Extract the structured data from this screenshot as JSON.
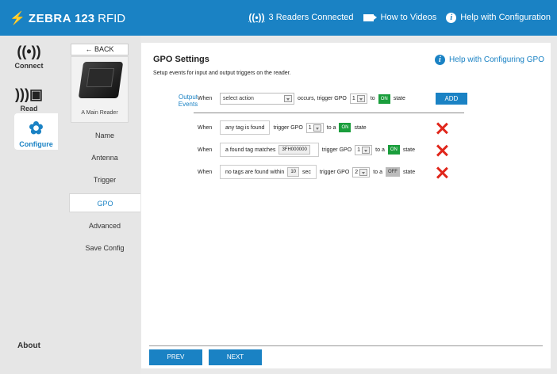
{
  "header": {
    "brand_name": "ZEBRA",
    "brand_product": "123",
    "brand_product_suffix": "RFID",
    "readers_connected": "3 Readers Connected",
    "how_to_videos": "How to Videos",
    "help_config": "Help with Configuration"
  },
  "nav": {
    "connect": "Connect",
    "read": "Read",
    "configure": "Configure",
    "about": "About"
  },
  "subnav": {
    "back": "← BACK",
    "reader_name": "A Main Reader",
    "items": [
      "Name",
      "Antenna",
      "Trigger",
      "GPO",
      "Advanced",
      "Save Config"
    ],
    "active": "GPO"
  },
  "main": {
    "title": "GPO Settings",
    "help": "Help with Configuring GPO",
    "description": "Setup events for input and output triggers on the reader.",
    "output_events_label": "Output Events",
    "builder": {
      "when": "When",
      "select_action": "select action",
      "occurs_text": "occurs, trigger GPO",
      "gpo": "1",
      "to_text": "to",
      "state": "ON",
      "state_text": "state",
      "add": "ADD"
    },
    "events": [
      {
        "when": "When",
        "condition": "any tag is found",
        "cond_value": "",
        "cond_unit": "",
        "trigger_text": "trigger GPO",
        "gpo": "1",
        "to_a": "to a",
        "state": "ON",
        "state_text": "state"
      },
      {
        "when": "When",
        "condition": "a found tag matches",
        "cond_value": "3FH000000",
        "cond_unit": "",
        "trigger_text": "trigger GPO",
        "gpo": "1",
        "to_a": "to a",
        "state": "ON",
        "state_text": "state"
      },
      {
        "when": "When",
        "condition": "no tags are found within",
        "cond_value": "10",
        "cond_unit": "sec",
        "trigger_text": "trigger GPO",
        "gpo": "2",
        "to_a": "to a",
        "state": "OFF",
        "state_text": "state"
      }
    ],
    "prev": "PREV",
    "next": "NEXT"
  },
  "colors": {
    "accent": "#1a82c4",
    "on": "#1a9e3c",
    "off": "#bbbbbb",
    "delete": "#e0261b"
  }
}
